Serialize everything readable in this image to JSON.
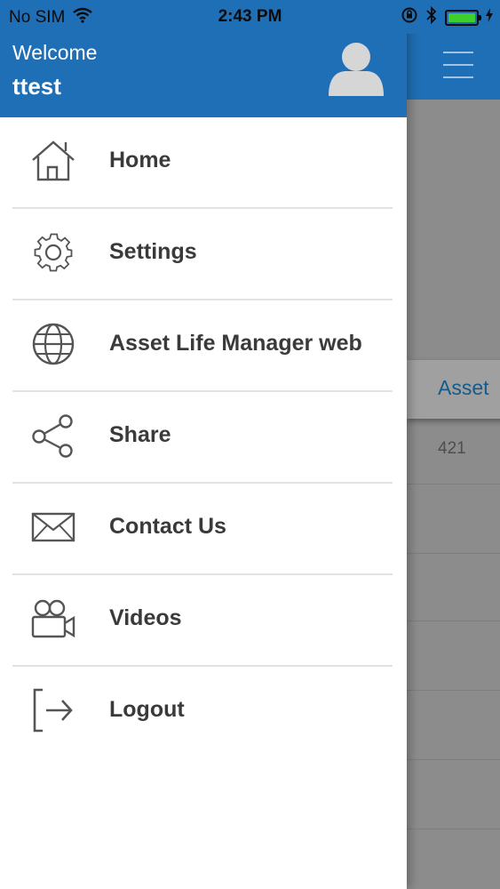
{
  "status_bar": {
    "carrier": "No SIM",
    "time": "2:43 PM",
    "battery_color": "#3ecf2f"
  },
  "drawer": {
    "welcome_text": "Welcome",
    "username": "ttest",
    "avatar_icon": "user-avatar-icon",
    "header_color": "#1f6fb7",
    "items": [
      {
        "label": "Home",
        "icon": "home-icon"
      },
      {
        "label": "Settings",
        "icon": "gear-icon"
      },
      {
        "label": "Asset Life Manager web",
        "icon": "globe-icon"
      },
      {
        "label": "Share",
        "icon": "share-icon"
      },
      {
        "label": "Contact Us",
        "icon": "envelope-icon"
      },
      {
        "label": "Videos",
        "icon": "video-camera-icon"
      },
      {
        "label": "Logout",
        "icon": "logout-icon"
      }
    ]
  },
  "background": {
    "card_label": "Asset",
    "value": "421"
  }
}
